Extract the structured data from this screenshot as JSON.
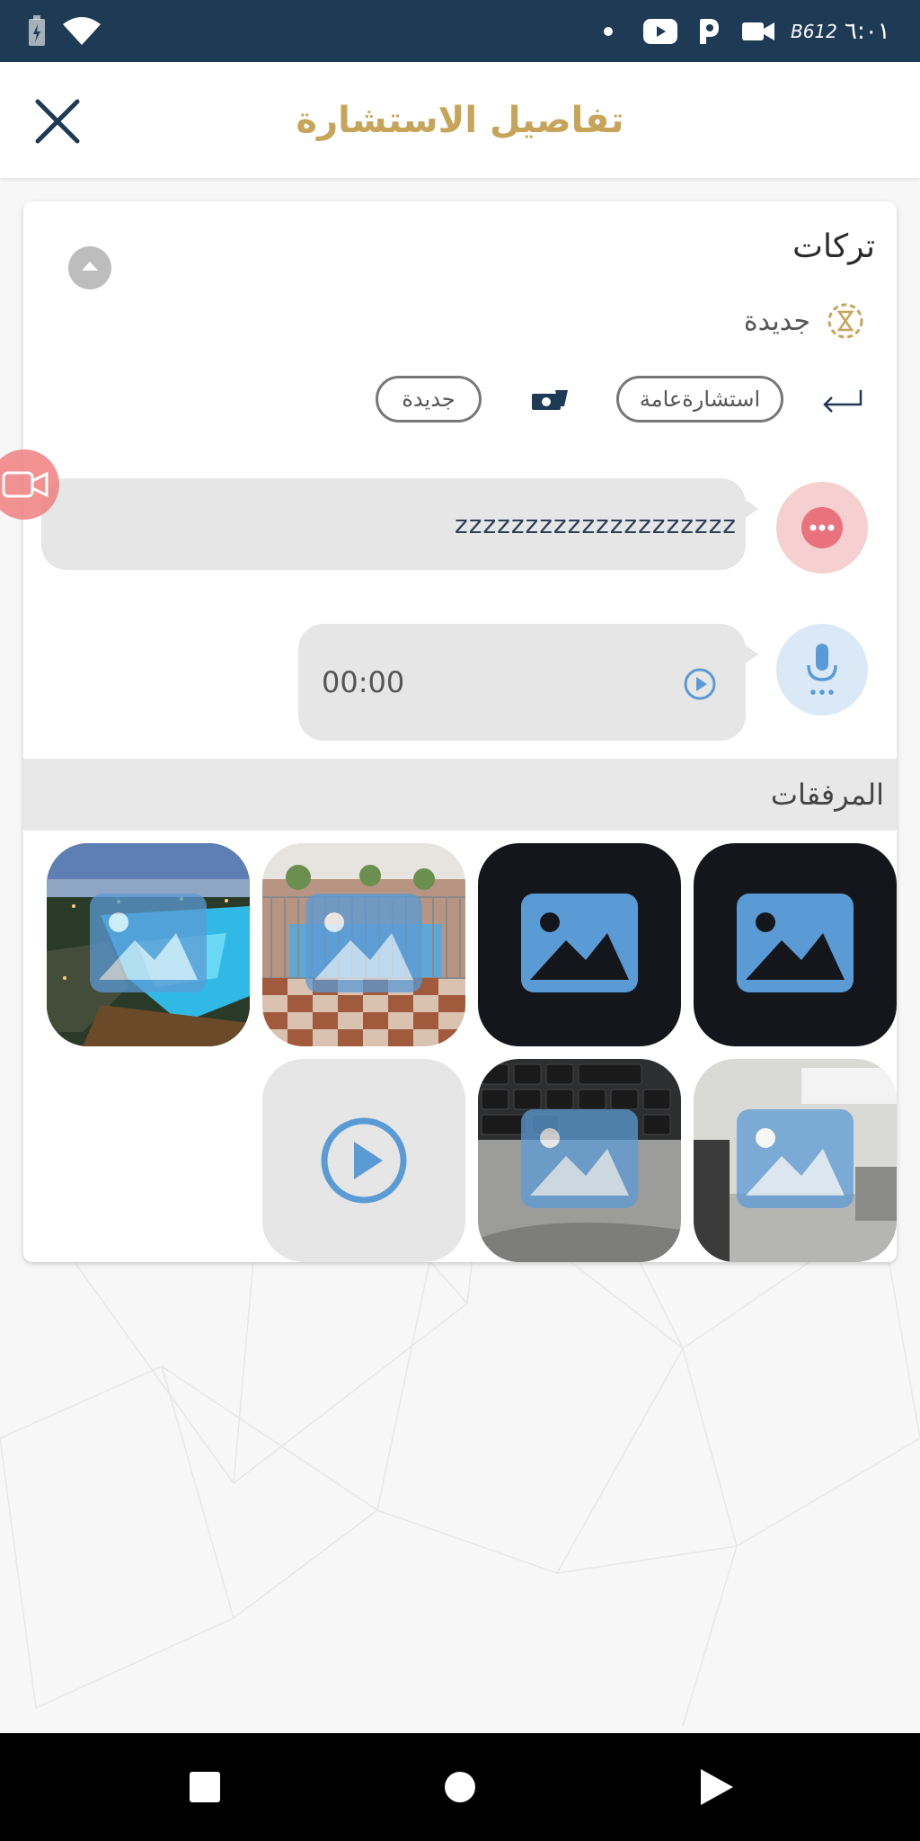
{
  "status_bar": {
    "time": "٦:٠١",
    "network": "B612"
  },
  "header": {
    "title": "تفاصيل الاستشارة"
  },
  "consultation": {
    "user_name": "تركات",
    "status": "جديدة",
    "tags": {
      "type": "استشارةعامة",
      "status": "جديدة"
    },
    "text_message": "zzzzzzzzzzzzzzzzzzzz",
    "audio_time": "00:00"
  },
  "attachments": {
    "title": "المرفقات",
    "items": [
      {
        "kind": "image",
        "scene": "dark"
      },
      {
        "kind": "image",
        "scene": "dark"
      },
      {
        "kind": "image",
        "scene": "fence-pool"
      },
      {
        "kind": "image",
        "scene": "resort-pool"
      },
      {
        "kind": "image",
        "scene": "room"
      },
      {
        "kind": "image",
        "scene": "keyboard"
      },
      {
        "kind": "video",
        "scene": "video"
      }
    ]
  },
  "colors": {
    "status_bar": "#1f3a55",
    "title_gold": "#c6a55b",
    "icon_blue": "#5b9bd5",
    "message_pink": "#f4c8c8",
    "audio_blue": "#dbe9f7"
  },
  "icons": {
    "close": "close-icon",
    "collapse": "chevron-up-icon",
    "status": "hourglass-icon",
    "reply": "reply-arrow-icon",
    "payment": "money-icon",
    "more": "more-dots-icon",
    "mic": "microphone-icon",
    "play": "play-icon",
    "video_call": "video-camera-icon"
  }
}
